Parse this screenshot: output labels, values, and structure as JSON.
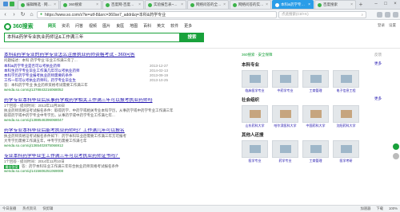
{
  "tabs": [
    {
      "label": "编辑精选 · 网易行业协会",
      "active": false
    },
    {
      "label": "360搜索",
      "active": false
    },
    {
      "label": "百度网-百度一下",
      "active": false
    },
    {
      "label": "实验报告表~gusijun",
      "active": false
    },
    {
      "label": "网络问答的全部精选",
      "active": false
    },
    {
      "label": "网络问答的实验报告",
      "active": false
    },
    {
      "label": "本科&药学专业实践考试",
      "active": true
    },
    {
      "label": "百度搜索",
      "active": false
    }
  ],
  "address": {
    "url": "https://www.so.com/s?ie=utf-8&src=360se7_addr&q=本科&药学专业",
    "search_placeholder": "点此搜索(Ctrl+K)"
  },
  "search": {
    "logo_text": "360搜索",
    "tabs": [
      "网页",
      "资讯",
      "问答",
      "视频",
      "图片",
      "良医",
      "地图",
      "百科",
      "英文",
      "软件",
      "更多"
    ],
    "active_tab": "网页",
    "query": "本科&药学专业执业药师证&工作满三年",
    "button_label": "搜索",
    "user_links": [
      "登录",
      "设置"
    ]
  },
  "results": [
    {
      "title": "本科&药学专业的药学专业怎么注册执业药师资格考试 - 360问答",
      "lines": [
        "问题描述：本科 药学专业 毕业工作满三年了...",
        "答：本科药学专业 执业药师资格考试需要工作满三年"
      ],
      "sublinks": [
        {
          "title": "本科&药学专业是否可以考执业药师",
          "date": "2013-12-27"
        },
        {
          "title": "本科生药学专业毕业工作满几年可以考执业药师",
          "date": "2014-02-13"
        },
        {
          "title": "本科学历药学专业报考执业药师需要的条件",
          "date": "2013-09-19"
        },
        {
          "title": "工作一年可以考执业药师吗，药学专业毕业生",
          "date": "2013-10-25"
        }
      ],
      "url": "wenda.so.com/q/1378843216068052"
    },
    {
      "title": "药学专业本科毕业后从事药学或药学相关工作满三年可以报考执业药师吗",
      "lines": [
        "1个回答 - 提问时间：2013年12月30日",
        "执业药师资格证考试报名条件：取得药学、中药学或相关专业本科学历，从事药学或中药学专业工作满三年",
        "取得药学或中药学专业中专学历，从事药学或中药学专业工作满七年..."
      ],
      "sublinks": [],
      "url": "wenda.so.com/q/1388546396068047"
    },
    {
      "title": "药学专业本科毕业后能考执业药师吗？工作满几年可以报名",
      "lines": [
        "执业药师资格证考试报名条件如下：药学本科毕业后需要工作满三年方可报考",
        "大专学历需要工作满五年，中专学历需要工作满七年"
      ],
      "sublinks": [],
      "url": "wenda.so.com/q/1365402875066912"
    },
    {
      "title": "专业本科药学毕业生工作满三年可以考执业药师证书吗？",
      "lines": [
        "1个回答 - 提问时间：2014年11月10日",
        "答：药学本科毕业工作满三年符合执业药师资格考试报名条件"
      ],
      "tag": "最佳答案",
      "sublinks": [],
      "url": "wenda.so.com/q/1415606251069008"
    }
  ],
  "right_panel": {
    "ad_label": "360搜索 · 安全保障",
    "feedback": "反馈",
    "sections": [
      {
        "title": "本科专业",
        "more": "更多",
        "items": [
          {
            "caption": "临床医学专业"
          },
          {
            "caption": "中药学专业"
          },
          {
            "caption": "工商管理"
          },
          {
            "caption": "电子信息工程"
          }
        ]
      },
      {
        "title": "社会组织",
        "more": "更多",
        "items": [
          {
            "caption": "山东药科大学"
          },
          {
            "caption": "哈尔滨医科大学"
          },
          {
            "caption": "中国药科大学"
          },
          {
            "caption": "沈阳药科大学"
          }
        ]
      },
      {
        "title": "其他人还搜",
        "more": "",
        "items": [
          {
            "caption": "医学专业"
          },
          {
            "caption": "药学专业"
          },
          {
            "caption": "工商管理"
          },
          {
            "caption": "医学考研"
          }
        ]
      }
    ]
  },
  "status": {
    "left": [
      "今日直播",
      "热点资讯",
      "快剪辑"
    ],
    "right": [
      "加速器",
      "下载",
      "100%"
    ]
  }
}
